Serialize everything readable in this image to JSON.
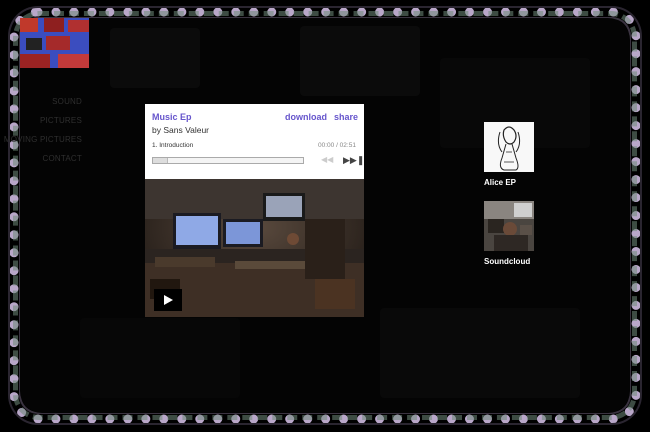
{
  "nav": {
    "items": [
      {
        "label": "SOUND"
      },
      {
        "label": "PICTURES"
      },
      {
        "label": "MOVING PICTURES"
      },
      {
        "label": "CONTACT"
      }
    ]
  },
  "player": {
    "title": "Music Ep",
    "artist": "by Sans Valeur",
    "download_label": "download",
    "share_label": "share",
    "track": "1.  Introduction",
    "time": "00:00 / 02:51",
    "progress": 0
  },
  "sidebar": {
    "items": [
      {
        "label": "Alice EP"
      },
      {
        "label": "Soundcloud"
      }
    ]
  },
  "colors": {
    "accent": "#6655cc",
    "logo": "#3b4dbf"
  }
}
